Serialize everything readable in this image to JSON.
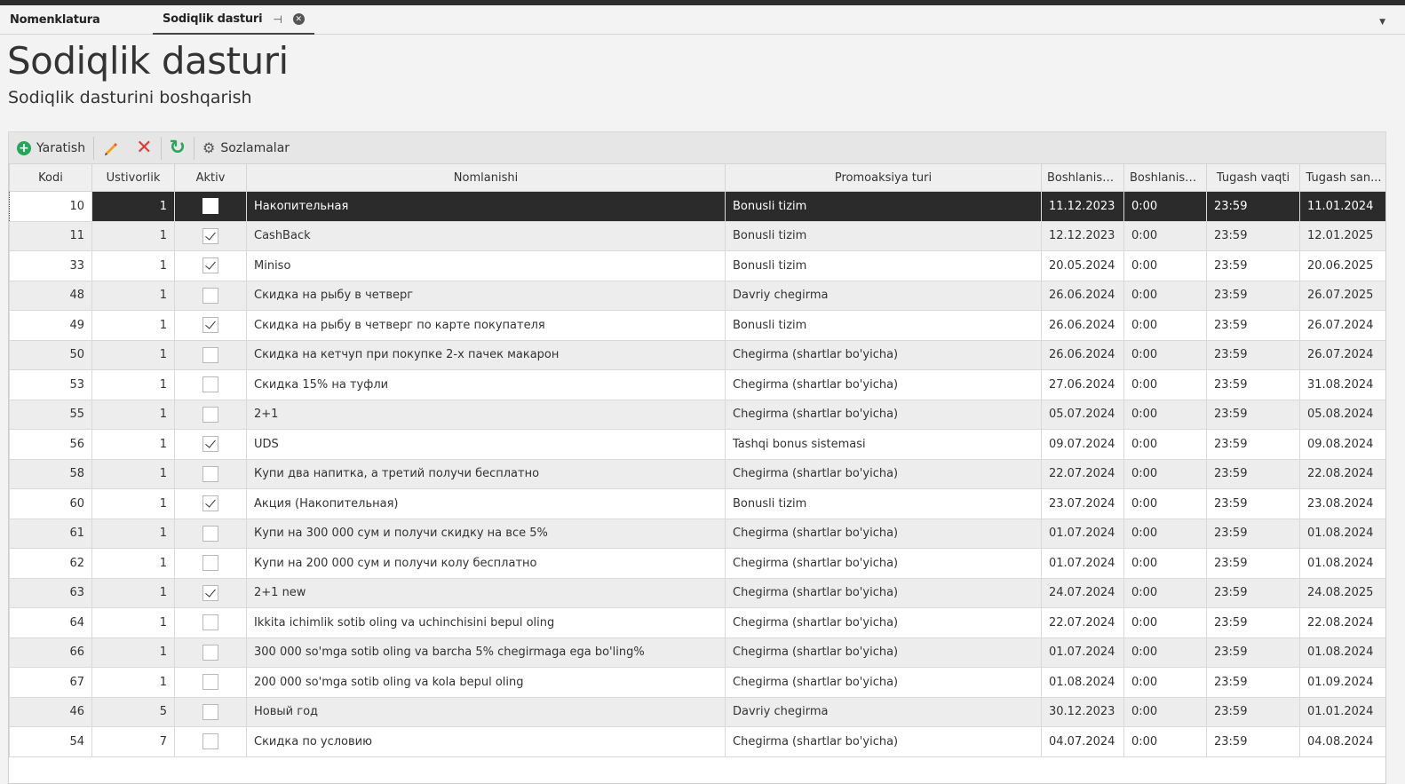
{
  "tabs": [
    {
      "label": "Nomenklatura",
      "active": false
    },
    {
      "label": "Sodiqlik dasturi",
      "active": true
    }
  ],
  "page": {
    "title": "Sodiqlik dasturi",
    "subtitle": "Sodiqlik dasturini boshqarish"
  },
  "toolbar": {
    "create_label": "Yaratish",
    "settings_label": "Sozlamalar"
  },
  "colors": {
    "accent_green": "#27a55a",
    "delete_red": "#e03a3a",
    "selected_row": "#2b2b2b"
  },
  "columns": [
    "Kodi",
    "Ustivorlik",
    "Aktiv",
    "Nomlanishi",
    "Promoaksiya turi",
    "Boshlanish...",
    "Boshlanish...",
    "Tugash vaqti",
    "Tugash san..."
  ],
  "rows": [
    {
      "kodi": "10",
      "ustivorlik": "1",
      "aktiv": false,
      "nom": "Накопительная",
      "tur": "Bonusli tizim",
      "b_sana": "11.12.2023",
      "b_vaqt": "0:00",
      "t_vaqt": "23:59",
      "t_sana": "11.01.2024",
      "selected": true
    },
    {
      "kodi": "11",
      "ustivorlik": "1",
      "aktiv": true,
      "nom": "CashBack",
      "tur": "Bonusli tizim",
      "b_sana": "12.12.2023",
      "b_vaqt": "0:00",
      "t_vaqt": "23:59",
      "t_sana": "12.01.2025"
    },
    {
      "kodi": "33",
      "ustivorlik": "1",
      "aktiv": true,
      "nom": "Miniso",
      "tur": "Bonusli tizim",
      "b_sana": "20.05.2024",
      "b_vaqt": "0:00",
      "t_vaqt": "23:59",
      "t_sana": "20.06.2025"
    },
    {
      "kodi": "48",
      "ustivorlik": "1",
      "aktiv": false,
      "nom": "Скидка на рыбу в четверг",
      "tur": "Davriy chegirma",
      "b_sana": "26.06.2024",
      "b_vaqt": "0:00",
      "t_vaqt": "23:59",
      "t_sana": "26.07.2025"
    },
    {
      "kodi": "49",
      "ustivorlik": "1",
      "aktiv": true,
      "nom": "Скидка на рыбу в четверг по карте покупателя",
      "tur": "Bonusli tizim",
      "b_sana": "26.06.2024",
      "b_vaqt": "0:00",
      "t_vaqt": "23:59",
      "t_sana": "26.07.2024"
    },
    {
      "kodi": "50",
      "ustivorlik": "1",
      "aktiv": false,
      "nom": "Скидка на кетчуп при покупке 2-х пачек макарон",
      "tur": "Chegirma (shartlar bo'yicha)",
      "b_sana": "26.06.2024",
      "b_vaqt": "0:00",
      "t_vaqt": "23:59",
      "t_sana": "26.07.2024"
    },
    {
      "kodi": "53",
      "ustivorlik": "1",
      "aktiv": false,
      "nom": "Скидка 15% на туфли",
      "tur": "Chegirma (shartlar bo'yicha)",
      "b_sana": "27.06.2024",
      "b_vaqt": "0:00",
      "t_vaqt": "23:59",
      "t_sana": "31.08.2024"
    },
    {
      "kodi": "55",
      "ustivorlik": "1",
      "aktiv": false,
      "nom": "2+1",
      "tur": "Chegirma (shartlar bo'yicha)",
      "b_sana": "05.07.2024",
      "b_vaqt": "0:00",
      "t_vaqt": "23:59",
      "t_sana": "05.08.2024"
    },
    {
      "kodi": "56",
      "ustivorlik": "1",
      "aktiv": true,
      "nom": "UDS",
      "tur": "Tashqi bonus sistemasi",
      "b_sana": "09.07.2024",
      "b_vaqt": "0:00",
      "t_vaqt": "23:59",
      "t_sana": "09.08.2024"
    },
    {
      "kodi": "58",
      "ustivorlik": "1",
      "aktiv": false,
      "nom": "Купи два напитка, а третий получи бесплатно",
      "tur": "Chegirma (shartlar bo'yicha)",
      "b_sana": "22.07.2024",
      "b_vaqt": "0:00",
      "t_vaqt": "23:59",
      "t_sana": "22.08.2024"
    },
    {
      "kodi": "60",
      "ustivorlik": "1",
      "aktiv": true,
      "nom": "Акция (Накопительная)",
      "tur": "Bonusli tizim",
      "b_sana": "23.07.2024",
      "b_vaqt": "0:00",
      "t_vaqt": "23:59",
      "t_sana": "23.08.2024"
    },
    {
      "kodi": "61",
      "ustivorlik": "1",
      "aktiv": false,
      "nom": "Купи на 300 000 сум и получи скидку на все 5%",
      "tur": "Chegirma (shartlar bo'yicha)",
      "b_sana": "01.07.2024",
      "b_vaqt": "0:00",
      "t_vaqt": "23:59",
      "t_sana": "01.08.2024"
    },
    {
      "kodi": "62",
      "ustivorlik": "1",
      "aktiv": false,
      "nom": "Купи на 200 000 сум и получи колу бесплатно",
      "tur": "Chegirma (shartlar bo'yicha)",
      "b_sana": "01.07.2024",
      "b_vaqt": "0:00",
      "t_vaqt": "23:59",
      "t_sana": "01.08.2024"
    },
    {
      "kodi": "63",
      "ustivorlik": "1",
      "aktiv": true,
      "nom": "2+1 new",
      "tur": "Chegirma (shartlar bo'yicha)",
      "b_sana": "24.07.2024",
      "b_vaqt": "0:00",
      "t_vaqt": "23:59",
      "t_sana": "24.08.2025"
    },
    {
      "kodi": "64",
      "ustivorlik": "1",
      "aktiv": false,
      "nom": "Ikkita ichimlik sotib oling va uchinchisini bepul oling",
      "tur": "Chegirma (shartlar bo'yicha)",
      "b_sana": "22.07.2024",
      "b_vaqt": "0:00",
      "t_vaqt": "23:59",
      "t_sana": "22.08.2024"
    },
    {
      "kodi": "66",
      "ustivorlik": "1",
      "aktiv": false,
      "nom": "300 000 so'mga sotib oling va barcha 5% chegirmaga ega bo'ling%",
      "tur": "Chegirma (shartlar bo'yicha)",
      "b_sana": "01.07.2024",
      "b_vaqt": "0:00",
      "t_vaqt": "23:59",
      "t_sana": "01.08.2024"
    },
    {
      "kodi": "67",
      "ustivorlik": "1",
      "aktiv": false,
      "nom": "200 000 so'mga sotib oling va kola bepul oling",
      "tur": "Chegirma (shartlar bo'yicha)",
      "b_sana": "01.08.2024",
      "b_vaqt": "0:00",
      "t_vaqt": "23:59",
      "t_sana": "01.09.2024"
    },
    {
      "kodi": "46",
      "ustivorlik": "5",
      "aktiv": false,
      "nom": "Новый год",
      "tur": "Davriy chegirma",
      "b_sana": "30.12.2023",
      "b_vaqt": "0:00",
      "t_vaqt": "23:59",
      "t_sana": "01.01.2024"
    },
    {
      "kodi": "54",
      "ustivorlik": "7",
      "aktiv": false,
      "nom": "Скидка по условию",
      "tur": "Chegirma (shartlar bo'yicha)",
      "b_sana": "04.07.2024",
      "b_vaqt": "0:00",
      "t_vaqt": "23:59",
      "t_sana": "04.08.2024"
    }
  ]
}
